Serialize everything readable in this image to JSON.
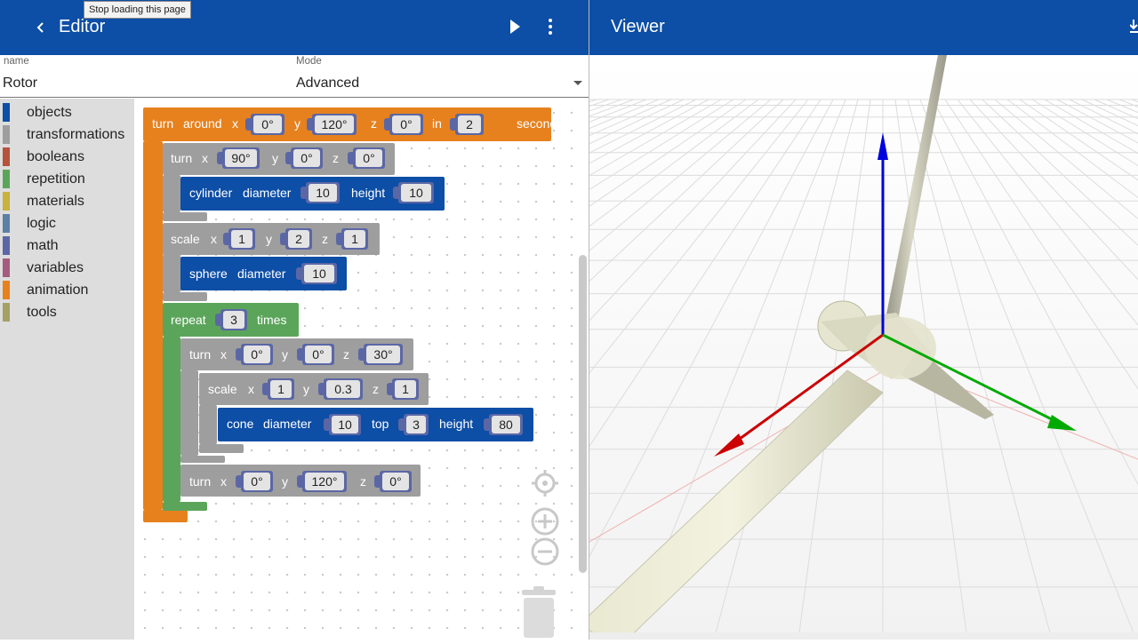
{
  "tooltip": "Stop loading this page",
  "editor": {
    "title": "Editor",
    "name_label": "name",
    "name_value": "Rotor",
    "mode_label": "Mode",
    "mode_value": "Advanced"
  },
  "viewer": {
    "title": "Viewer"
  },
  "toolbox": [
    {
      "label": "objects",
      "color": "#0d4ea6"
    },
    {
      "label": "transformations",
      "color": "#9e9e9e"
    },
    {
      "label": "booleans",
      "color": "#b5533c"
    },
    {
      "label": "repetition",
      "color": "#5ba55b"
    },
    {
      "label": "materials",
      "color": "#c8b23c"
    },
    {
      "label": "logic",
      "color": "#5b80a5"
    },
    {
      "label": "math",
      "color": "#5b67a5"
    },
    {
      "label": "variables",
      "color": "#a55b80"
    },
    {
      "label": "animation",
      "color": "#e6811e"
    },
    {
      "label": "tools",
      "color": "#a5a065"
    }
  ],
  "colors": {
    "header": "#0d4ea6",
    "animation": "#e6811e",
    "transform": "#9e9e9e",
    "object": "#0d4ea6",
    "repeat": "#5ba55b",
    "slot": "#5b67a5"
  },
  "blocks": {
    "turn_around": {
      "w1": "turn",
      "w2": "around",
      "x": "x",
      "xv": "0°",
      "y": "y",
      "yv": "120°",
      "z": "z",
      "zv": "0°",
      "in": "in",
      "dur": "2",
      "unit": "seconds"
    },
    "turn1": {
      "w": "turn",
      "x": "x",
      "xv": "90°",
      "y": "y",
      "yv": "0°",
      "z": "z",
      "zv": "0°"
    },
    "cylinder": {
      "w": "cylinder",
      "d": "diameter",
      "dv": "10",
      "h": "height",
      "hv": "10"
    },
    "scale1": {
      "w": "scale",
      "x": "x",
      "xv": "1",
      "y": "y",
      "yv": "2",
      "z": "z",
      "zv": "1"
    },
    "sphere": {
      "w": "sphere",
      "d": "diameter",
      "dv": "10"
    },
    "repeat": {
      "w": "repeat",
      "n": "3",
      "times": "times"
    },
    "turn2": {
      "w": "turn",
      "x": "x",
      "xv": "0°",
      "y": "y",
      "yv": "0°",
      "z": "z",
      "zv": "30°"
    },
    "scale2": {
      "w": "scale",
      "x": "x",
      "xv": "1",
      "y": "y",
      "yv": "0.3",
      "z": "z",
      "zv": "1"
    },
    "cone": {
      "w": "cone",
      "d": "diameter",
      "dv": "10",
      "t": "top",
      "tv": "3",
      "h": "height",
      "hv": "80"
    },
    "turn3": {
      "w": "turn",
      "x": "x",
      "xv": "0°",
      "y": "y",
      "yv": "120°",
      "z": "z",
      "zv": "0°"
    }
  }
}
